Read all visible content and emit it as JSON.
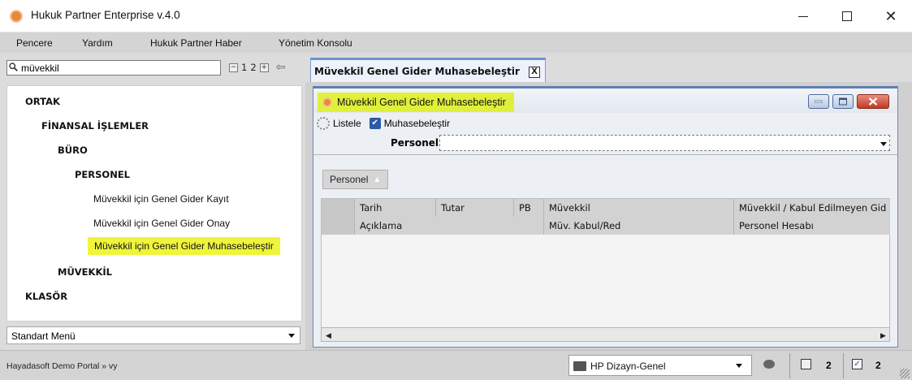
{
  "window": {
    "title": "Hukuk Partner Enterprise v.4.0"
  },
  "menu": [
    "Pencere",
    "Yardım",
    "Hukuk Partner Haber",
    "Yönetim Konsolu"
  ],
  "sidebar": {
    "search_value": "müvekkil",
    "pager": {
      "page1": "1",
      "page2": "2"
    },
    "tree": [
      {
        "label": "ORTAK"
      },
      {
        "label": "FİNANSAL İŞLEMLER"
      },
      {
        "label": "BÜRO"
      },
      {
        "label": "PERSONEL"
      },
      {
        "label": "Müvekkil için Genel Gider Kayıt"
      },
      {
        "label": "Müvekkil için Genel Gider Onay"
      },
      {
        "label": "Müvekkil için Genel Gider Muhasebeleştir"
      },
      {
        "label": "MÜVEKKİL"
      },
      {
        "label": "KLASÖR"
      }
    ],
    "menu_select": "Standart Menü"
  },
  "tab": {
    "label": "Müvekkil Genel Gider Muhasebeleştir",
    "close": "X"
  },
  "form": {
    "title": "Müvekkil Genel Gider Muhasebeleştir",
    "toolbar": {
      "list_label": "Listele",
      "post_label": "Muhasebeleştir"
    },
    "filter": {
      "label": "Personel",
      "value": ""
    },
    "group_by": "Personel",
    "grid": {
      "row1": [
        "Tarih",
        "Tutar",
        "PB",
        "Müvekkil",
        "Müvekkil / Kabul Edilmeyen Gid"
      ],
      "row2": [
        "Açıklama",
        "Müv. Kabul/Red",
        "Personel Hesabı"
      ]
    }
  },
  "status": {
    "breadcrumb": "Hayadasoft Demo Portal » vy",
    "design": "HP Dizayn-Genel",
    "calendar_count": "2",
    "task_count": "2"
  },
  "colors": {
    "highlight": "#f0f43a",
    "accent": "#6c94cf"
  }
}
